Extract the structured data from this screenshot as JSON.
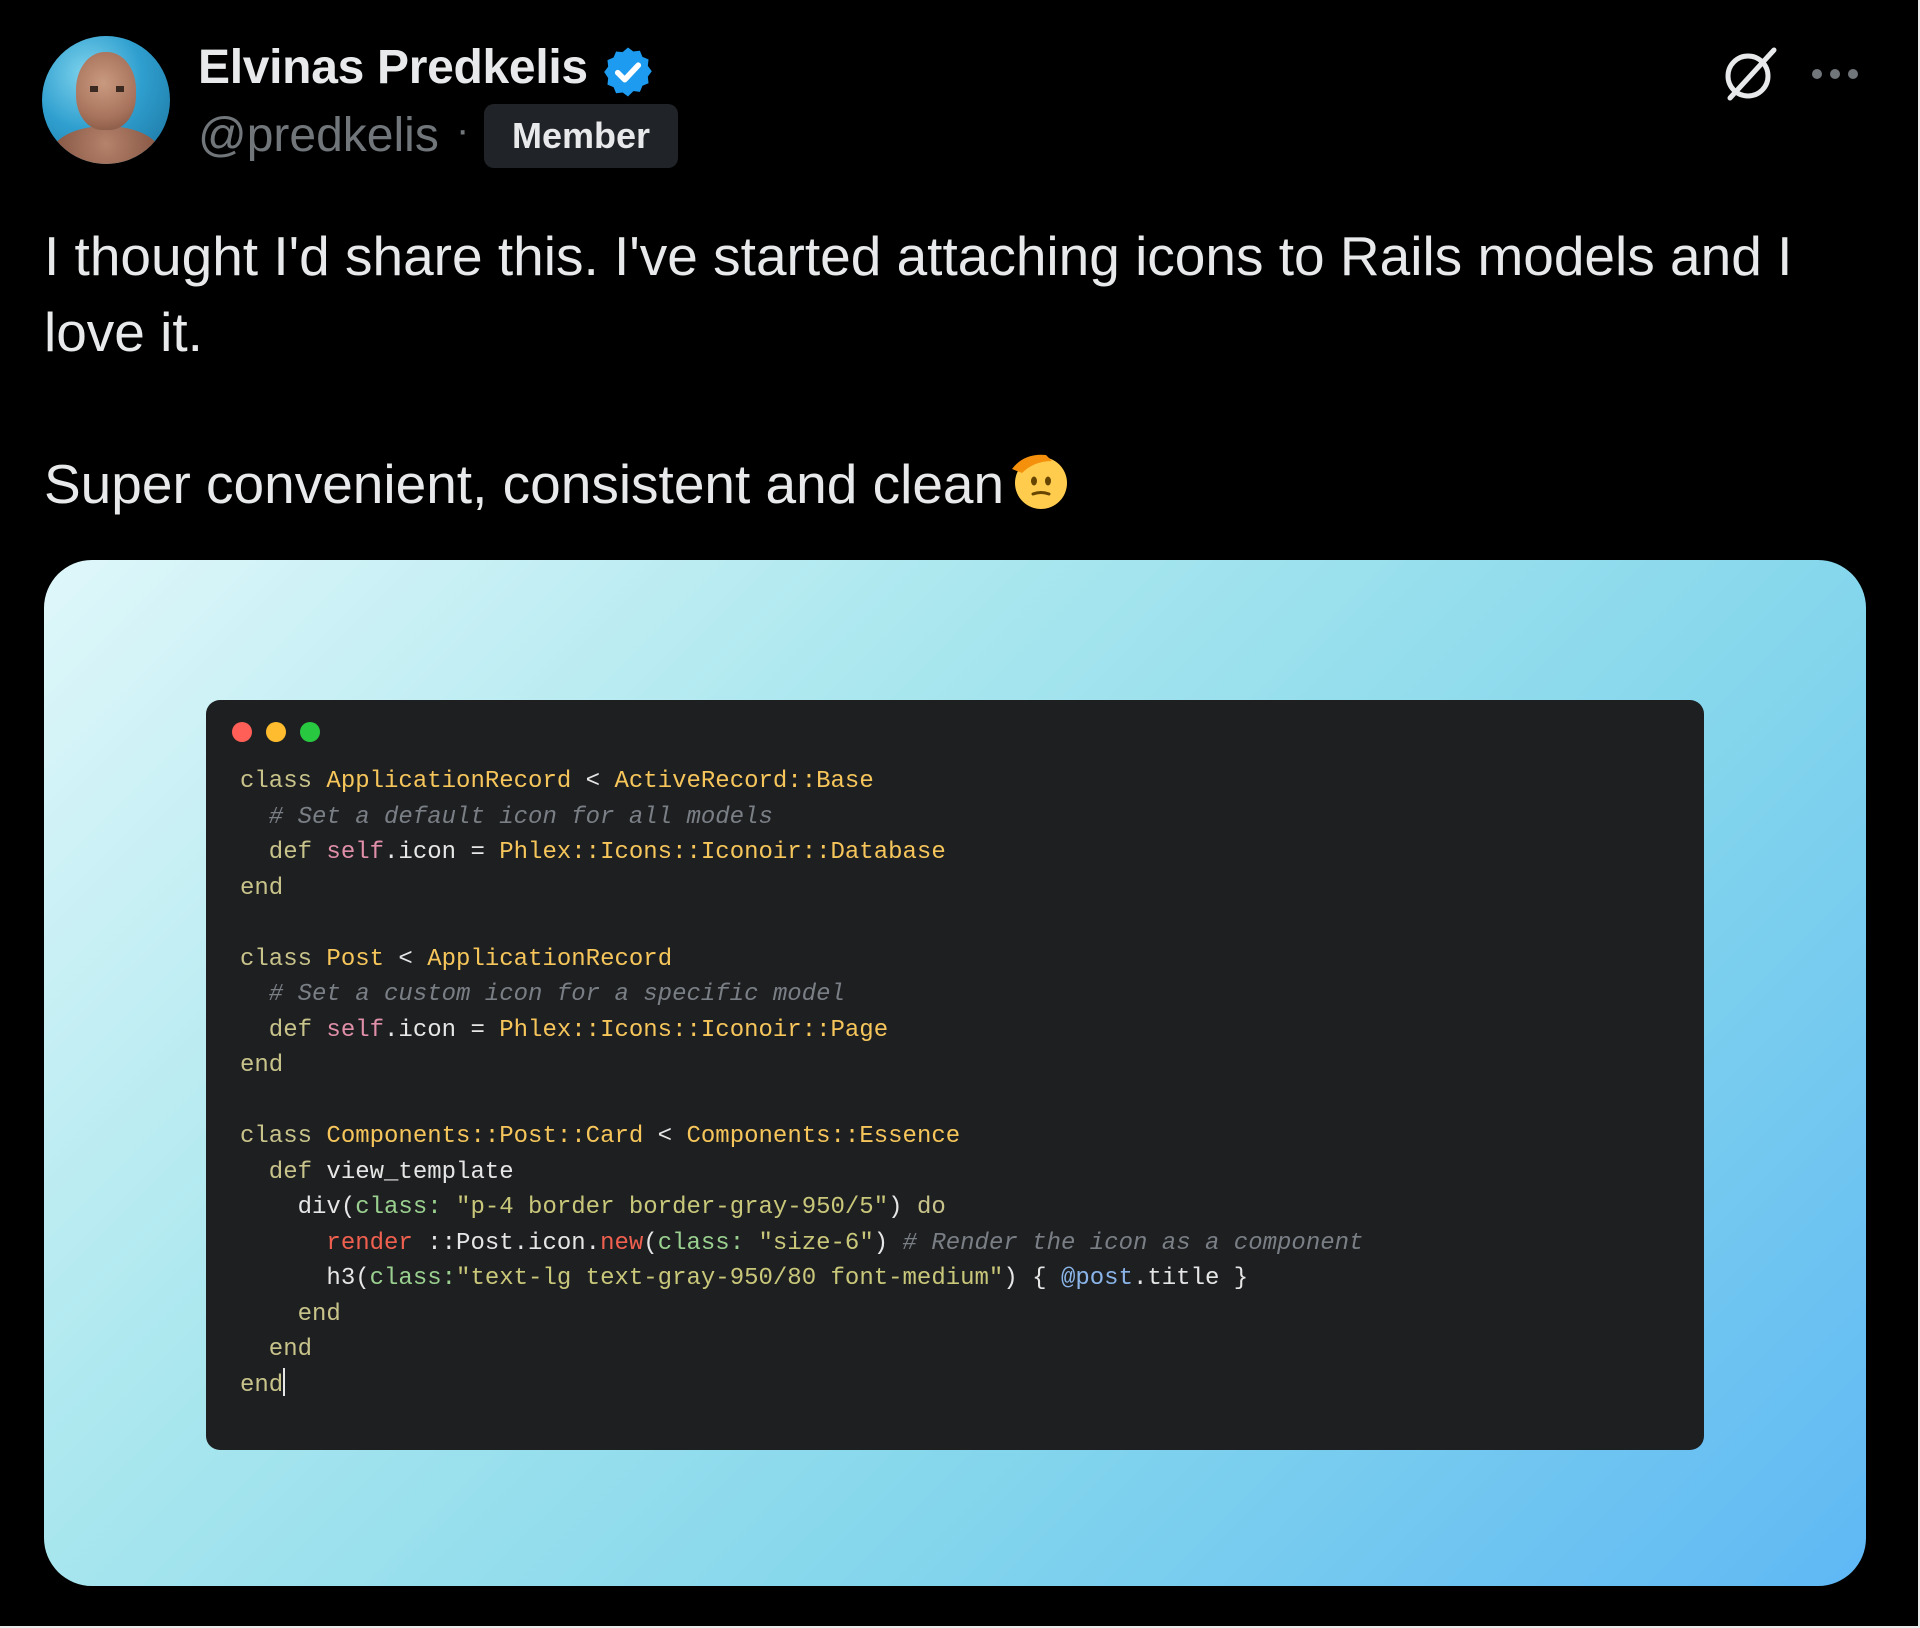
{
  "post": {
    "author_name": "Elvinas Predkelis",
    "handle": "@predkelis",
    "separator": "·",
    "badge": "Member",
    "text_line1": "I thought I'd share this. I've started attaching icons to Rails models and I love it.",
    "text_line2": "Super convenient, consistent and clean",
    "emoji": "saluting-face",
    "icons": {
      "verified": "verified-badge-icon",
      "grok": "grok-icon",
      "more": "more-options-icon"
    },
    "colors": {
      "background": "#000000",
      "text": "#e7e9ea",
      "muted": "#71767b",
      "verified": "#1d9bf0"
    }
  },
  "code": {
    "lines": [
      [
        {
          "t": "class ",
          "c": "kw"
        },
        {
          "t": "ApplicationRecord",
          "c": "cls"
        },
        {
          "t": " < ",
          "c": ""
        },
        {
          "t": "ActiveRecord::Base",
          "c": "cls"
        }
      ],
      [
        {
          "t": "  # Set a default icon for all models",
          "c": "cm"
        }
      ],
      [
        {
          "t": "  def ",
          "c": "kw"
        },
        {
          "t": "self",
          "c": "slf"
        },
        {
          "t": ".icon = ",
          "c": ""
        },
        {
          "t": "Phlex::Icons::Iconoir::Database",
          "c": "cls"
        }
      ],
      [
        {
          "t": "end",
          "c": "kw"
        }
      ],
      [
        {
          "t": "",
          "c": ""
        }
      ],
      [
        {
          "t": "class ",
          "c": "kw"
        },
        {
          "t": "Post",
          "c": "cls"
        },
        {
          "t": " < ",
          "c": ""
        },
        {
          "t": "ApplicationRecord",
          "c": "cls"
        }
      ],
      [
        {
          "t": "  # Set a custom icon for a specific model",
          "c": "cm"
        }
      ],
      [
        {
          "t": "  def ",
          "c": "kw"
        },
        {
          "t": "self",
          "c": "slf"
        },
        {
          "t": ".icon = ",
          "c": ""
        },
        {
          "t": "Phlex::Icons::Iconoir::Page",
          "c": "cls"
        }
      ],
      [
        {
          "t": "end",
          "c": "kw"
        }
      ],
      [
        {
          "t": "",
          "c": ""
        }
      ],
      [
        {
          "t": "class ",
          "c": "kw"
        },
        {
          "t": "Components::Post::Card",
          "c": "cls"
        },
        {
          "t": " < ",
          "c": ""
        },
        {
          "t": "Components::Essence",
          "c": "cls"
        }
      ],
      [
        {
          "t": "  def ",
          "c": "kw"
        },
        {
          "t": "view_template",
          "c": ""
        }
      ],
      [
        {
          "t": "    div(",
          "c": ""
        },
        {
          "t": "class:",
          "c": "sym"
        },
        {
          "t": " \"p-4 border border-gray-950/5\"",
          "c": "str"
        },
        {
          "t": ") ",
          "c": ""
        },
        {
          "t": "do",
          "c": "kw"
        }
      ],
      [
        {
          "t": "      render",
          "c": "rnd"
        },
        {
          "t": " ::Post.icon.",
          "c": ""
        },
        {
          "t": "new",
          "c": "rnd"
        },
        {
          "t": "(",
          "c": ""
        },
        {
          "t": "class:",
          "c": "sym"
        },
        {
          "t": " \"size-6\"",
          "c": "str"
        },
        {
          "t": ") ",
          "c": ""
        },
        {
          "t": "# Render the icon as a component",
          "c": "cm"
        }
      ],
      [
        {
          "t": "      h3(",
          "c": ""
        },
        {
          "t": "class:",
          "c": "sym"
        },
        {
          "t": "\"text-lg text-gray-950/80 font-medium\"",
          "c": "str"
        },
        {
          "t": ") { ",
          "c": ""
        },
        {
          "t": "@post",
          "c": "ivar"
        },
        {
          "t": ".title }",
          "c": ""
        }
      ],
      [
        {
          "t": "    end",
          "c": "kw"
        }
      ],
      [
        {
          "t": "  end",
          "c": "kw"
        }
      ],
      [
        {
          "t": "end",
          "c": "kw"
        }
      ]
    ]
  }
}
